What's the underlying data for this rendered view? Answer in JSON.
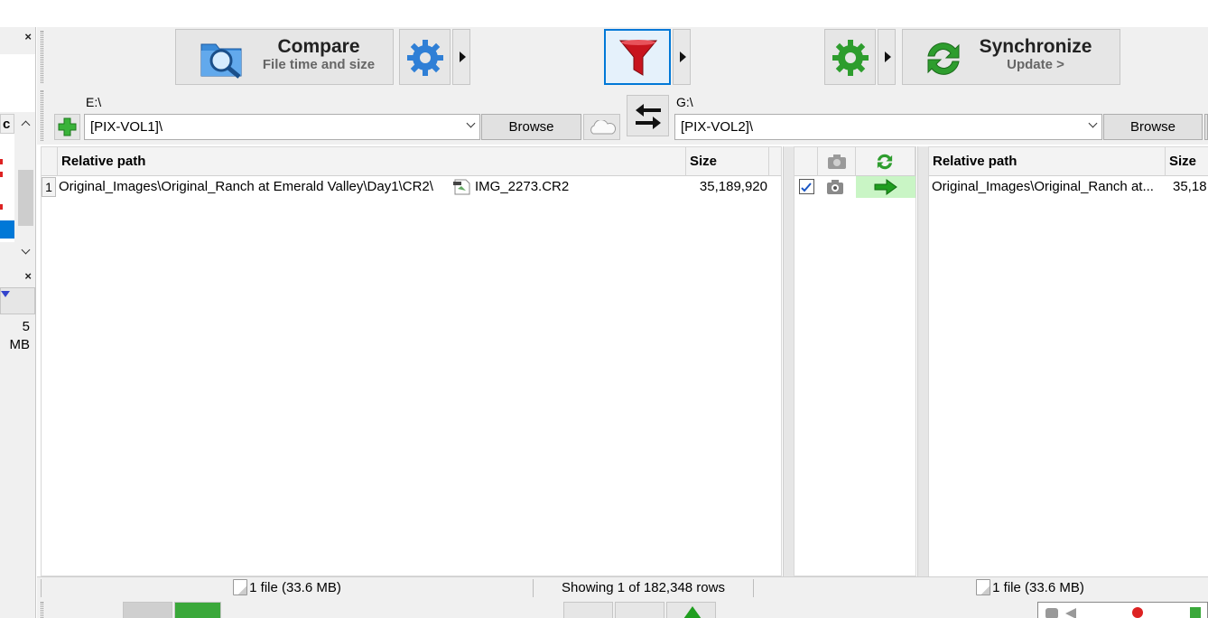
{
  "left_panel": {
    "close_label": "×",
    "list_header": "c",
    "close2_label": "×",
    "size_text": "5 MB"
  },
  "toolbar": {
    "compare_label": "Compare",
    "compare_sub": "File time and size",
    "synchronize_label": "Synchronize",
    "synchronize_sub": "Update >"
  },
  "folders": {
    "left_drive": "E:\\",
    "left_path": "[PIX-VOL1]\\",
    "left_browse": "Browse",
    "right_drive": "G:\\",
    "right_path": "[PIX-VOL2]\\",
    "right_browse": "Browse"
  },
  "left_grid": {
    "col_path": "Relative path",
    "col_size": "Size",
    "rows": [
      {
        "num": "1",
        "dir": "Original_Images\\Original_Ranch at Emerald Valley\\Day1\\CR2\\",
        "file": "IMG_2273.CR2",
        "size": "35,189,920"
      }
    ]
  },
  "right_grid": {
    "col_path": "Relative path",
    "col_size": "Size",
    "rows": [
      {
        "path": "Original_Images\\Original_Ranch at...",
        "size": "35,18"
      }
    ]
  },
  "status": {
    "left_files": "1 file (33.6 MB)",
    "showing": "Showing 1 of 182,348 rows",
    "right_files": "1 file (33.6 MB)"
  },
  "colors": {
    "accent_blue": "#0078d7",
    "sync_green": "#2e9d2e",
    "filter_red": "#c8141e",
    "action_bg": "#c9f5c5"
  }
}
